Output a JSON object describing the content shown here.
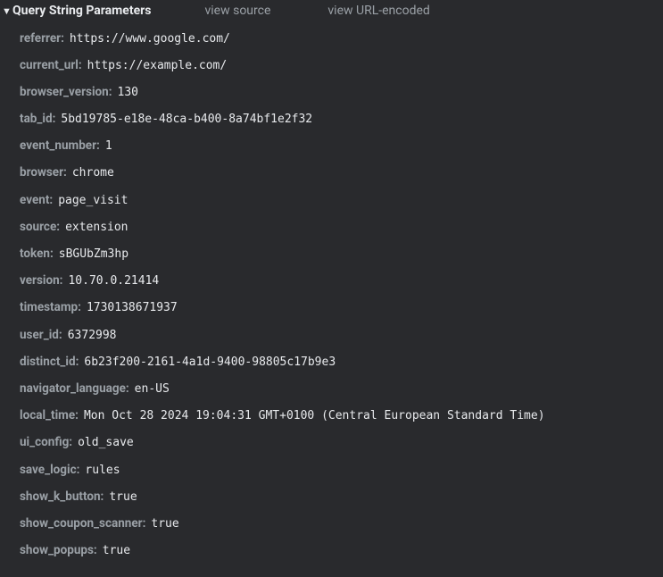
{
  "header": {
    "title": "Query String Parameters",
    "view_source": "view source",
    "view_url_encoded": "view URL-encoded"
  },
  "params": [
    {
      "key": "referrer",
      "value": "https://www.google.com/"
    },
    {
      "key": "current_url",
      "value": "https://example.com/"
    },
    {
      "key": "browser_version",
      "value": "130"
    },
    {
      "key": "tab_id",
      "value": "5bd19785-e18e-48ca-b400-8a74bf1e2f32"
    },
    {
      "key": "event_number",
      "value": "1"
    },
    {
      "key": "browser",
      "value": "chrome"
    },
    {
      "key": "event",
      "value": "page_visit"
    },
    {
      "key": "source",
      "value": "extension"
    },
    {
      "key": "token",
      "value": "sBGUbZm3hp"
    },
    {
      "key": "version",
      "value": "10.70.0.21414"
    },
    {
      "key": "timestamp",
      "value": "1730138671937"
    },
    {
      "key": "user_id",
      "value": "6372998"
    },
    {
      "key": "distinct_id",
      "value": "6b23f200-2161-4a1d-9400-98805c17b9e3"
    },
    {
      "key": "navigator_language",
      "value": "en-US"
    },
    {
      "key": "local_time",
      "value": "Mon Oct 28 2024 19:04:31 GMT+0100 (Central European Standard Time)"
    },
    {
      "key": "ui_config",
      "value": "old_save"
    },
    {
      "key": "save_logic",
      "value": "rules"
    },
    {
      "key": "show_k_button",
      "value": "true"
    },
    {
      "key": "show_coupon_scanner",
      "value": "true"
    },
    {
      "key": "show_popups",
      "value": "true"
    }
  ]
}
